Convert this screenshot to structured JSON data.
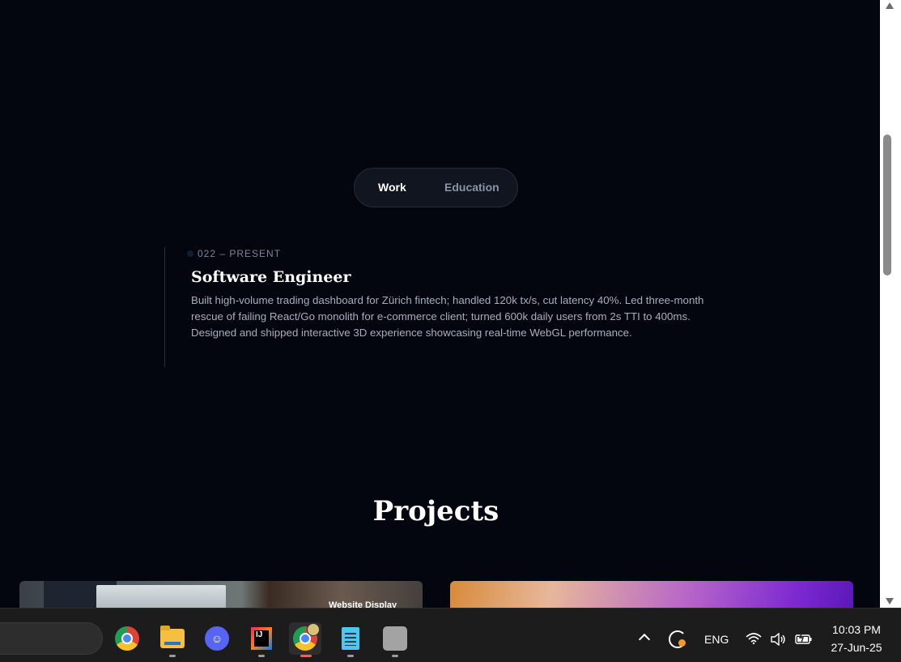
{
  "experience": {
    "tabs": [
      {
        "label": "Work",
        "active": true
      },
      {
        "label": "Education",
        "active": false
      }
    ],
    "entries": [
      {
        "date": "022 – PRESENT",
        "title": "Software Engineer",
        "description": "Built high-volume trading dashboard for Zürich fintech; handled 120k tx/s, cut latency 40%. Led three-month rescue of failing React/Go monolith for e-commerce client; turned 600k daily users from 2s TTI to 400ms. Designed and shipped interactive 3D experience showcasing real-time WebGL performance."
      }
    ]
  },
  "projects": {
    "heading": "Projects",
    "cards": [
      {
        "label": "Website Display"
      },
      {
        "label": ""
      }
    ]
  },
  "taskbar": {
    "apps": [
      {
        "icon": "chrome-icon"
      },
      {
        "icon": "file-explorer-icon"
      },
      {
        "icon": "discord-icon"
      },
      {
        "icon": "intellij-icon"
      },
      {
        "icon": "chrome-profile-icon",
        "active": true
      },
      {
        "icon": "notepad-icon"
      },
      {
        "icon": "gray-app-icon"
      }
    ],
    "tray": {
      "language": "ENG",
      "time": "10:03 PM",
      "date": "27-Jun-25"
    }
  },
  "colors": {
    "page_bg": "#03060f",
    "accent_indicator": "#e0675a"
  }
}
